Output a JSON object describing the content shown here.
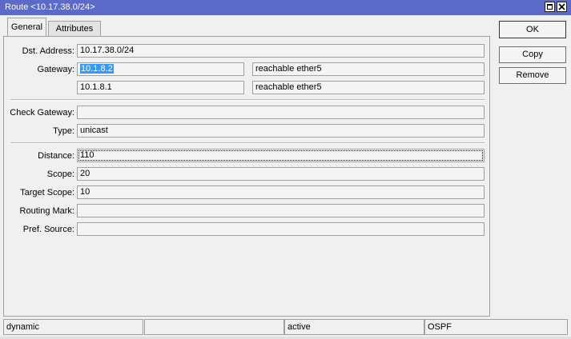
{
  "window": {
    "title": "Route <10.17.38.0/24>"
  },
  "tabs": [
    {
      "label": "General",
      "active": true
    },
    {
      "label": "Attributes",
      "active": false
    }
  ],
  "fields": {
    "dst_address": {
      "label": "Dst. Address:",
      "value": "10.17.38.0/24"
    },
    "gateway": {
      "label": "Gateway:",
      "entries": [
        {
          "address": "10.1.8.2",
          "status": "reachable ether5",
          "selected": true
        },
        {
          "address": "10.1.8.1",
          "status": "reachable ether5",
          "selected": false
        }
      ]
    },
    "check_gateway": {
      "label": "Check Gateway:",
      "value": ""
    },
    "type": {
      "label": "Type:",
      "value": "unicast"
    },
    "distance": {
      "label": "Distance:",
      "value": "110"
    },
    "scope": {
      "label": "Scope:",
      "value": "20"
    },
    "target_scope": {
      "label": "Target Scope:",
      "value": "10"
    },
    "routing_mark": {
      "label": "Routing Mark:",
      "value": ""
    },
    "pref_source": {
      "label": "Pref. Source:",
      "value": ""
    }
  },
  "buttons": {
    "ok": "OK",
    "copy": "Copy",
    "remove": "Remove"
  },
  "status_bar": [
    "dynamic",
    "",
    "active",
    "OSPF"
  ]
}
